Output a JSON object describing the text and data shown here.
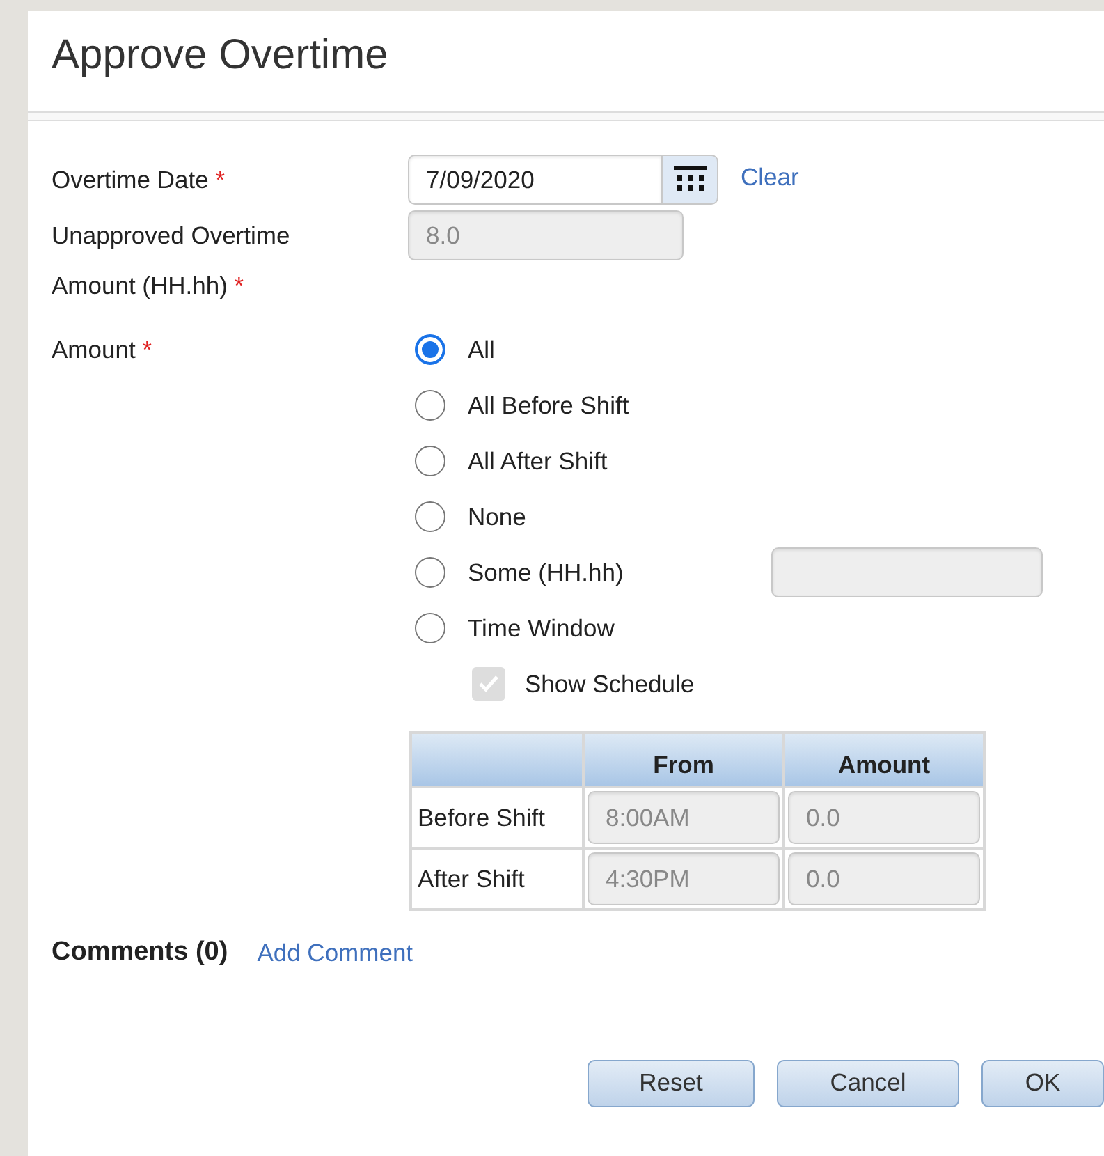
{
  "dialog": {
    "title": "Approve Overtime"
  },
  "date_field": {
    "label": "Overtime Date",
    "required_mark": "*",
    "value": "7/09/2020",
    "clear_link": "Clear"
  },
  "unapproved_field": {
    "label": "Unapproved Overtime Amount (HH.hh)",
    "required_mark": "*",
    "value": "8.0",
    "disabled": true
  },
  "amount": {
    "label": "Amount",
    "required_mark": "*",
    "options": [
      {
        "label": "All",
        "selected": true,
        "kind": "plain"
      },
      {
        "label": "All Before Shift",
        "selected": false,
        "kind": "plain"
      },
      {
        "label": "All After Shift",
        "selected": false,
        "kind": "plain"
      },
      {
        "label": "None",
        "selected": false,
        "kind": "plain"
      },
      {
        "label": "Some (HH.hh)",
        "selected": false,
        "kind": "with-field"
      },
      {
        "label": "Time Window",
        "selected": false,
        "kind": "plain"
      }
    ],
    "show_schedule": {
      "label": "Show Schedule",
      "checked": true,
      "disabled": true
    }
  },
  "schedule_table": {
    "columns": [
      "From",
      "Amount"
    ],
    "rows": [
      {
        "label": "Before Shift",
        "from": "8:00AM",
        "amount": "0.0"
      },
      {
        "label": "After Shift",
        "from": "4:30PM",
        "amount": "0.0"
      }
    ]
  },
  "comments": {
    "label": "Comments (0)",
    "link": "Add Comment"
  },
  "buttons": [
    "Reset",
    "Cancel",
    "OK"
  ]
}
